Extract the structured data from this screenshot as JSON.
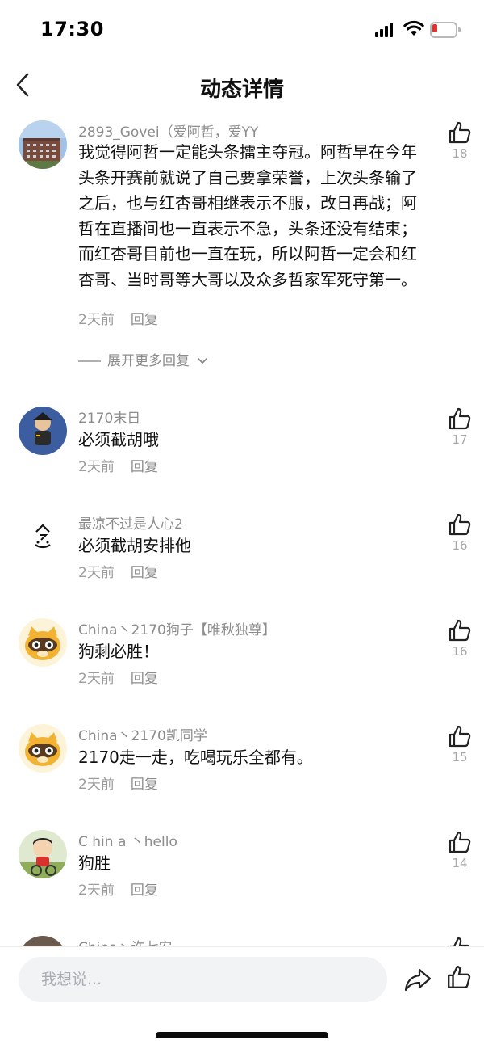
{
  "status_bar": {
    "time": "17:30",
    "battery_color": "#e0332f"
  },
  "nav": {
    "title": "动态详情",
    "back_icon": "chevron-left-icon"
  },
  "comments": [
    {
      "username": "2893_Govei（爱阿哲，爱YY",
      "text": "我觉得阿哲一定能头条擂主夺冠。阿哲早在今年头条开赛前就说了自己要拿荣誉，上次头条输了之后，也与红杏哥相继表示不服，改日再战；阿哲在直播间也一直表示不急，头条还没有结束；而红杏哥目前也一直在玩，所以阿哲一定会和红杏哥、当时哥等大哥以及众多哲家军死守第一。",
      "time": "2天前",
      "reply": "回复",
      "likes": "18",
      "avatar": "building-photo"
    },
    {
      "username": "2170末日",
      "text": "必须截胡哦",
      "time": "2天前",
      "reply": "回复",
      "likes": "17",
      "avatar": "cartoon-character"
    },
    {
      "username": "最凉不过是人心2",
      "text": "必须截胡安排他",
      "time": "2天前",
      "reply": "回复",
      "likes": "16",
      "avatar": "calligraphy"
    },
    {
      "username": "China丶2170狗子【唯秋独尊】",
      "text": "狗剩必胜！",
      "time": "2天前",
      "reply": "回复",
      "likes": "16",
      "avatar": "raccoon-cartoon"
    },
    {
      "username": "China丶2170凯同学",
      "text": "2170走一走，吃喝玩乐全都有。",
      "time": "2天前",
      "reply": "回复",
      "likes": "15",
      "avatar": "raccoon-cartoon"
    },
    {
      "username": "C hin a 丶hello",
      "text": "狗胜",
      "time": "2天前",
      "reply": "回复",
      "likes": "14",
      "avatar": "crayon-shinchan"
    },
    {
      "username": "China丶许七安",
      "text": "",
      "time": "",
      "reply": "",
      "likes": "",
      "avatar": "person-photo"
    }
  ],
  "expand_more": "展开更多回复",
  "bottom_bar": {
    "input_placeholder": "我想说..."
  }
}
